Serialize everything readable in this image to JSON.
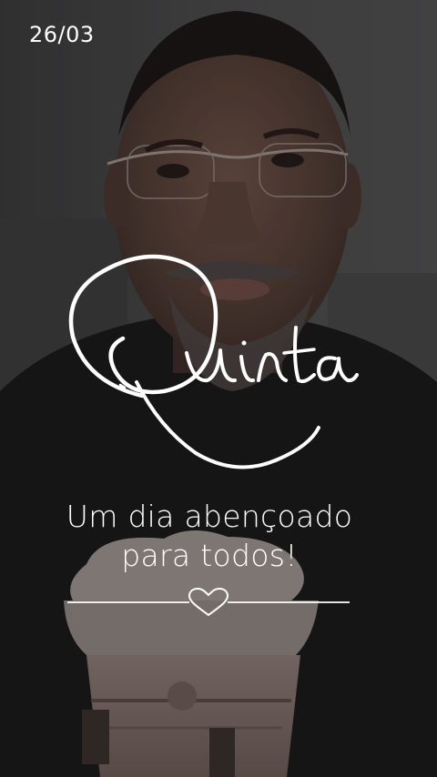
{
  "story": {
    "date": "26/03",
    "script_word": "Quinta",
    "subtitle_line1": "Um dia abençoado",
    "subtitle_line2": "para todos!"
  },
  "colors": {
    "text": "#ffffff",
    "background": "#1c1c1d"
  },
  "icons": {
    "divider": "heart-icon"
  }
}
